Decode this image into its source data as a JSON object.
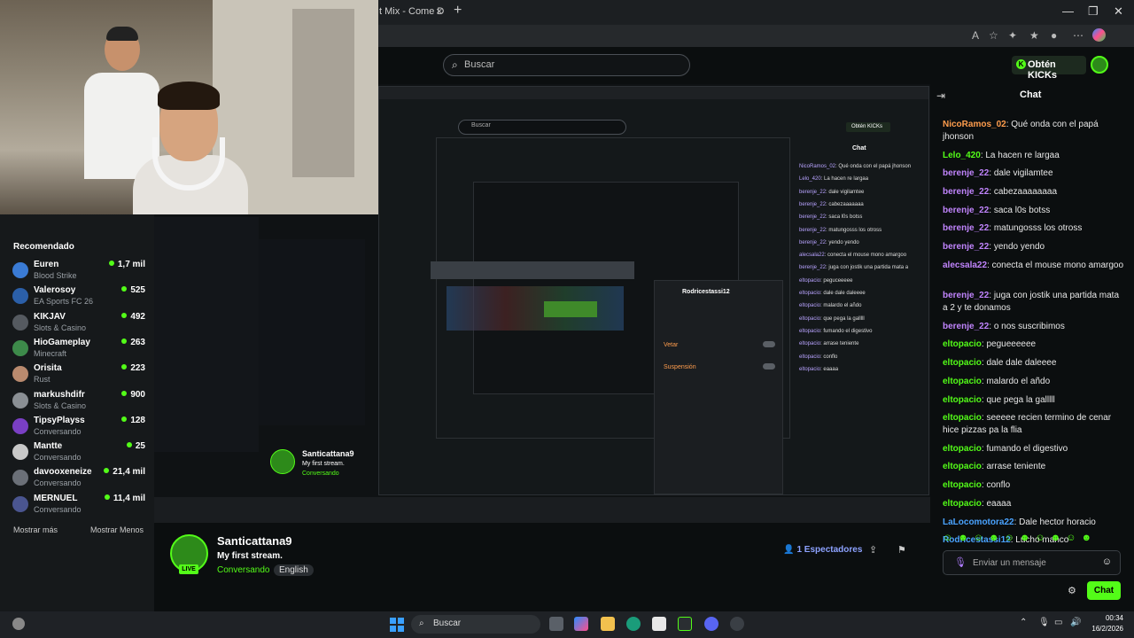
{
  "browser": {
    "tab_title": "t Mix - Come D",
    "tab_close": "×",
    "new_tab": "+",
    "window_controls": [
      "—",
      "❐",
      "✕"
    ]
  },
  "header": {
    "search_placeholder": "Buscar",
    "kicks_button": "Obtén KICKs",
    "kicks_glyph": "K"
  },
  "sidebar": {
    "title": "Recomendado",
    "items": [
      {
        "name": "Euren",
        "category": "Blood Strike",
        "viewers": "1,7 mil",
        "color": "#3a7bd5"
      },
      {
        "name": "Valerosoy",
        "category": "EA Sports FC 26",
        "viewers": "525",
        "color": "#2b5fa8"
      },
      {
        "name": "KIKJAV",
        "category": "Slots & Casino",
        "viewers": "492",
        "color": "#555a60"
      },
      {
        "name": "HioGameplay",
        "category": "Minecraft",
        "viewers": "263",
        "color": "#3d8a4a"
      },
      {
        "name": "Orisita",
        "category": "Rust",
        "viewers": "223",
        "color": "#b98a6e"
      },
      {
        "name": "markushdifr",
        "category": "Slots & Casino",
        "viewers": "900",
        "color": "#8a8f94"
      },
      {
        "name": "TipsyPlayss",
        "category": "Conversando",
        "viewers": "128",
        "color": "#7a3fc4"
      },
      {
        "name": "Mantte",
        "category": "Conversando",
        "viewers": "25",
        "color": "#c8c8c8"
      },
      {
        "name": "davooxeneize",
        "category": "Conversando",
        "viewers": "21,4 mil",
        "color": "#6b7078"
      },
      {
        "name": "MERNUEL",
        "category": "Conversando",
        "viewers": "11,4 mil",
        "color": "#4a5590"
      }
    ],
    "show_more": "Mostrar más",
    "show_less": "Mostrar Menos"
  },
  "nested": {
    "search_placeholder": "Buscar",
    "kicks_button": "Obtén KICKs",
    "chat_title": "Chat",
    "popup_user": "Rodricestassi12",
    "popup_veto": "Vetar",
    "popup_suspend": "Suspensión",
    "stream_name": "Santicattana9",
    "stream_title": "My first stream.",
    "stream_category": "Conversando",
    "chat_lines": [
      {
        "user": "NicoRamos_02",
        "text": "Qué onda con el papá jhonson"
      },
      {
        "user": "Lelo_420",
        "text": "La hacen re largaa"
      },
      {
        "user": "berenje_22",
        "text": "dale vigilamtee"
      },
      {
        "user": "berenje_22",
        "text": "cabezaaaaaaa"
      },
      {
        "user": "berenje_22",
        "text": "saca l0s botss"
      },
      {
        "user": "berenje_22",
        "text": "matungosss los otross"
      },
      {
        "user": "berenje_22",
        "text": "yendo yendo"
      },
      {
        "user": "alecsala22",
        "text": "conecta el mouse mono amargoo"
      },
      {
        "user": "berenje_22",
        "text": "juga con jostik una partida mata a"
      },
      {
        "user": "eltopacio",
        "text": "peguceeeee"
      },
      {
        "user": "eltopacio",
        "text": "dale dale daleeee"
      },
      {
        "user": "eltopacio",
        "text": "malardo el añdo"
      },
      {
        "user": "eltopacio",
        "text": "que pega la galllll"
      },
      {
        "user": "eltopacio",
        "text": "fumando el digestivo"
      },
      {
        "user": "eltopacio",
        "text": "arrase teniente"
      },
      {
        "user": "eltopacio",
        "text": "conflo"
      },
      {
        "user": "eltopacio",
        "text": "eaaaa"
      }
    ]
  },
  "stream": {
    "streamer": "Santicattana9",
    "title": "My first stream.",
    "category": "Conversando",
    "language": "English",
    "live_badge": "LIVE",
    "viewers_count": "1",
    "viewers_label": "Espectadores"
  },
  "chat": {
    "title": "Chat",
    "messages": [
      {
        "user": "NicoRamos_02",
        "text": "Qué onda con el papá jhonson",
        "color": "#ff9d4d"
      },
      {
        "user": "Lelo_420",
        "text": "La hacen re largaa",
        "color": "#53fc18"
      },
      {
        "user": "berenje_22",
        "text": "dale vigilamtee",
        "color": "#c084fc"
      },
      {
        "user": "berenje_22",
        "text": "cabezaaaaaaaa",
        "color": "#c084fc"
      },
      {
        "user": "berenje_22",
        "text": "saca l0s botss",
        "color": "#c084fc"
      },
      {
        "user": "berenje_22",
        "text": "matungosss los otross",
        "color": "#c084fc"
      },
      {
        "user": "berenje_22",
        "text": "yendo yendo",
        "color": "#c084fc"
      },
      {
        "user": "alecsala22",
        "text": "conecta el mouse mono amargoo",
        "color": "#c084fc"
      },
      {
        "user": "berenje_22",
        "text": "juga con jostik una partida mata a 2 y te donamos",
        "color": "#c084fc"
      },
      {
        "user": "berenje_22",
        "text": "o nos suscribimos",
        "color": "#c084fc"
      },
      {
        "user": "eltopacio",
        "text": "pegueeeeee",
        "color": "#53fc18"
      },
      {
        "user": "eltopacio",
        "text": "dale dale daleeee",
        "color": "#53fc18"
      },
      {
        "user": "eltopacio",
        "text": "malardo el añdo",
        "color": "#53fc18"
      },
      {
        "user": "eltopacio",
        "text": "que pega la galllll",
        "color": "#53fc18"
      },
      {
        "user": "eltopacio",
        "text": "seeeee recien termino de cenar hice pizzas pa la flia",
        "color": "#53fc18"
      },
      {
        "user": "eltopacio",
        "text": "fumando el digestivo",
        "color": "#53fc18"
      },
      {
        "user": "eltopacio",
        "text": "arrase teniente",
        "color": "#53fc18"
      },
      {
        "user": "eltopacio",
        "text": "conflo",
        "color": "#53fc18"
      },
      {
        "user": "eltopacio",
        "text": "eaaaa",
        "color": "#53fc18"
      },
      {
        "user": "LaLocomotora22",
        "text": "Dale hector horacio",
        "color": "#4aa3ff"
      },
      {
        "user": "Rodricestassi12",
        "text": "Lucho manco",
        "color": "#4aa3ff"
      }
    ],
    "emotes": "☺☻☺☻☺☻☺☻☺☻",
    "input_placeholder": "Enviar un mensaje",
    "send_button": "Chat"
  },
  "taskbar": {
    "search_placeholder": "Buscar",
    "time": "00:34",
    "date": "16/2/2026"
  },
  "colors": {
    "accent": "#53fc18",
    "background": "#0b0e0f",
    "sidebar": "#16191b"
  }
}
